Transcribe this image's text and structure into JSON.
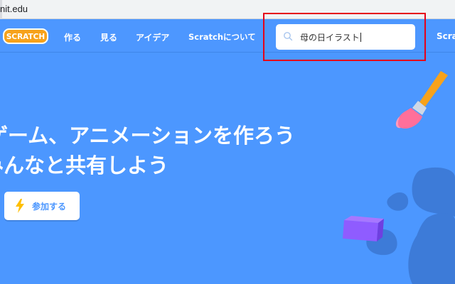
{
  "browser": {
    "url": "nit.edu"
  },
  "nav": {
    "logo_text": "SCRATCH",
    "create": "作る",
    "explore": "見る",
    "ideas": "アイデア",
    "about": "Scratchについて",
    "scratch_cut": "Scratc"
  },
  "search": {
    "value": "母の日イラスト"
  },
  "hero": {
    "line1": "ゲーム、アニメーションを作ろう",
    "line2": "みんなと共有しよう",
    "join_label": "参加する"
  },
  "colors": {
    "brand_blue": "#4c97ff",
    "highlight_red": "#e5001a",
    "logo_orange": "#f7a21b",
    "bolt_yellow": "#ffbf00"
  }
}
